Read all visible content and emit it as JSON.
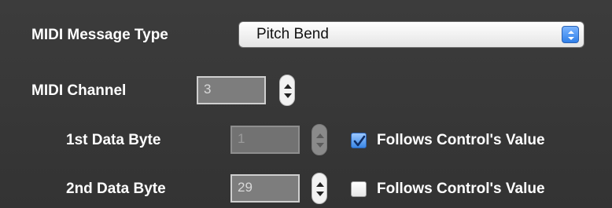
{
  "message_type": {
    "label": "MIDI Message Type",
    "value": "Pitch Bend"
  },
  "channel": {
    "label": "MIDI Channel",
    "value": "3"
  },
  "data_byte_1": {
    "label": "1st Data Byte",
    "value": "1",
    "enabled": false,
    "follows_label": "Follows Control's Value",
    "follows_checked": true
  },
  "data_byte_2": {
    "label": "2nd Data Byte",
    "value": "29",
    "enabled": true,
    "follows_label": "Follows Control's Value",
    "follows_checked": false
  },
  "colors": {
    "panel_bg": "#3a3a3a",
    "label_text": "#ffffff",
    "accent_blue": "#2f7fe8"
  },
  "icons": {
    "popup_arrows": "up-down-arrows-icon",
    "stepper": "stepper-arrows-icon",
    "checkmark": "checkmark-icon"
  }
}
